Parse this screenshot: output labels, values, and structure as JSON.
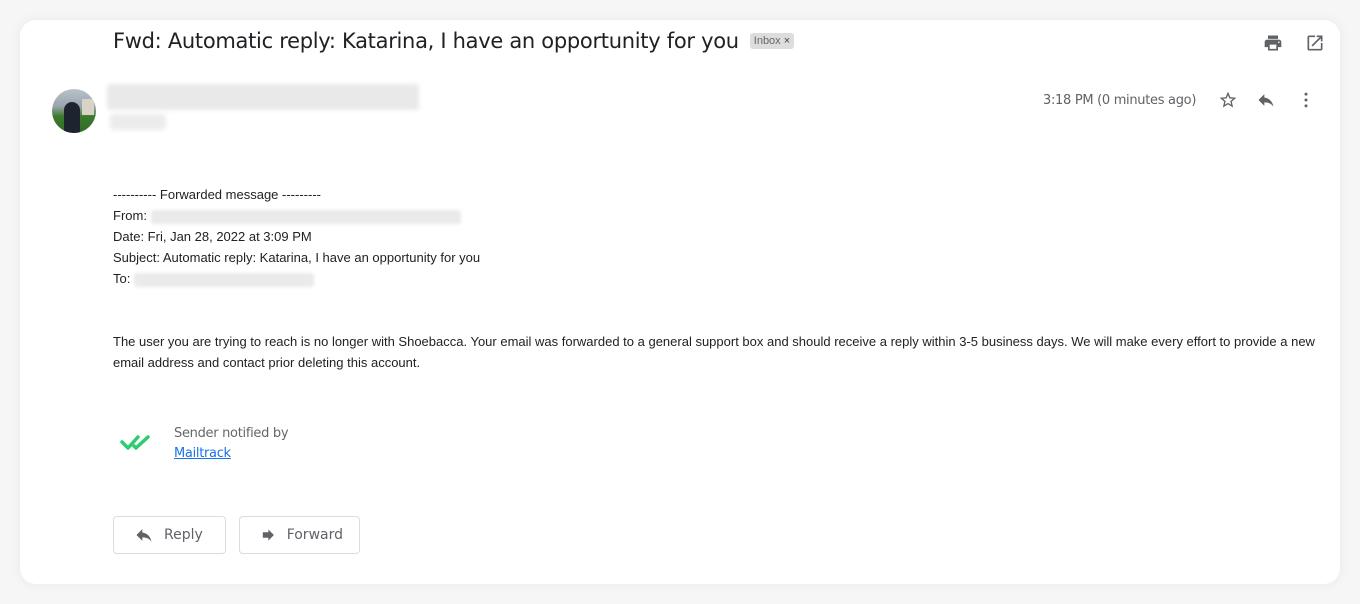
{
  "email": {
    "subject": "Fwd: Automatic reply: Katarina, I have an opportunity for you",
    "label_chip": {
      "text": "Inbox",
      "remove_glyph": "×"
    },
    "top_actions": [
      {
        "name": "print-icon",
        "label": "Print all"
      },
      {
        "name": "open-new-window-icon",
        "label": "In new window"
      }
    ],
    "sender": {
      "name": "[redacted]",
      "recipient_line": "[redacted]"
    },
    "timestamp": "3:18 PM (0 minutes ago)",
    "header_actions": [
      {
        "name": "star-icon"
      },
      {
        "name": "reply-icon"
      },
      {
        "name": "more-options-icon"
      }
    ],
    "forwarded": {
      "divider": "---------- Forwarded message ---------",
      "from_label": "From:",
      "date_line": "Date: Fri, Jan 28, 2022 at 3:09 PM",
      "subject_line": "Subject: Automatic reply: Katarina, I have an opportunity for you",
      "to_label": "To:"
    },
    "message": "The user you are trying to reach is no longer with Shoebacca. Your email was forwarded to a general support box and should receive a reply within 3-5 business days. We will make every effort to provide a new email address and contact prior deleting this account.",
    "mailtrack": {
      "notified_text": "Sender notified by",
      "link_text": "Mailtrack",
      "check_color": "#2ecc71"
    },
    "buttons": {
      "reply": "Reply",
      "forward": "Forward"
    }
  }
}
